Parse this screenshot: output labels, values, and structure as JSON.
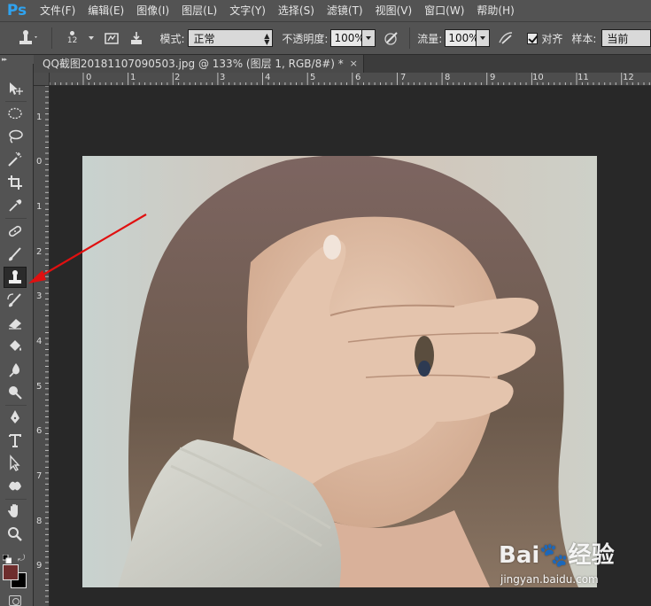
{
  "app": {
    "logo": "Ps"
  },
  "menu": [
    {
      "label": "文件(F)"
    },
    {
      "label": "编辑(E)"
    },
    {
      "label": "图像(I)"
    },
    {
      "label": "图层(L)"
    },
    {
      "label": "文字(Y)"
    },
    {
      "label": "选择(S)"
    },
    {
      "label": "滤镜(T)"
    },
    {
      "label": "视图(V)"
    },
    {
      "label": "窗口(W)"
    },
    {
      "label": "帮助(H)"
    }
  ],
  "options": {
    "brush_size": "12",
    "mode_label": "模式:",
    "mode_value": "正常",
    "opacity_label": "不透明度:",
    "opacity_value": "100%",
    "flow_label": "流量:",
    "flow_value": "100%",
    "aligned_label": "对齐",
    "sample_label": "样本:",
    "sample_value": "当前"
  },
  "document": {
    "tab_title": "QQ截图20181107090503.jpg @ 133% (图层 1, RGB/8#) *",
    "close_glyph": "×"
  },
  "rulers": {
    "top": [
      "0",
      "1",
      "2",
      "3",
      "4",
      "5",
      "6",
      "7",
      "8",
      "9",
      "10",
      "11",
      "12"
    ],
    "left": [
      "1",
      "0",
      "1",
      "2",
      "3",
      "4",
      "5",
      "6",
      "7",
      "8",
      "9"
    ]
  },
  "tools": [
    {
      "name": "move-tool-icon"
    },
    {
      "name": "marquee-tool-icon"
    },
    {
      "name": "lasso-tool-icon"
    },
    {
      "name": "magic-wand-tool-icon"
    },
    {
      "name": "crop-tool-icon"
    },
    {
      "name": "eyedropper-tool-icon"
    },
    {
      "name": "healing-brush-tool-icon"
    },
    {
      "name": "brush-tool-icon"
    },
    {
      "name": "clone-stamp-tool-icon",
      "active": true
    },
    {
      "name": "history-brush-tool-icon"
    },
    {
      "name": "eraser-tool-icon"
    },
    {
      "name": "paint-bucket-tool-icon"
    },
    {
      "name": "blur-tool-icon"
    },
    {
      "name": "dodge-tool-icon"
    },
    {
      "name": "pen-tool-icon"
    },
    {
      "name": "type-tool-icon"
    },
    {
      "name": "path-selection-tool-icon"
    },
    {
      "name": "custom-shape-tool-icon"
    },
    {
      "name": "hand-tool-icon"
    },
    {
      "name": "zoom-tool-icon"
    }
  ],
  "colors": {
    "foreground": "#6e2d2d",
    "background": "#000000",
    "ps_blue": "#2fa3f0",
    "annotation_red": "#e01010"
  },
  "watermark": {
    "logo": "Bai🐾经验",
    "url": "jingyan.baidu.com"
  }
}
